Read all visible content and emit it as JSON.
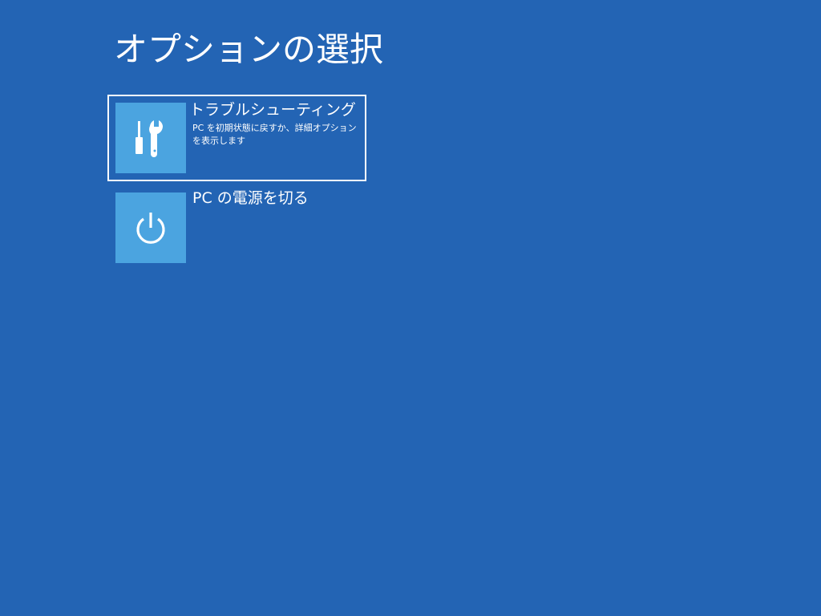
{
  "page": {
    "title": "オプションの選択"
  },
  "options": [
    {
      "label": "トラブルシューティング",
      "description": "PC を初期状態に戻すか、詳細オプションを表示します",
      "icon": "wrench-screwdriver-icon",
      "selected": true
    },
    {
      "label": "PC の電源を切る",
      "icon": "power-icon",
      "selected": false
    }
  ],
  "colors": {
    "background": "#2364b4",
    "tile": "#4ba4e0",
    "text": "#ffffff"
  }
}
